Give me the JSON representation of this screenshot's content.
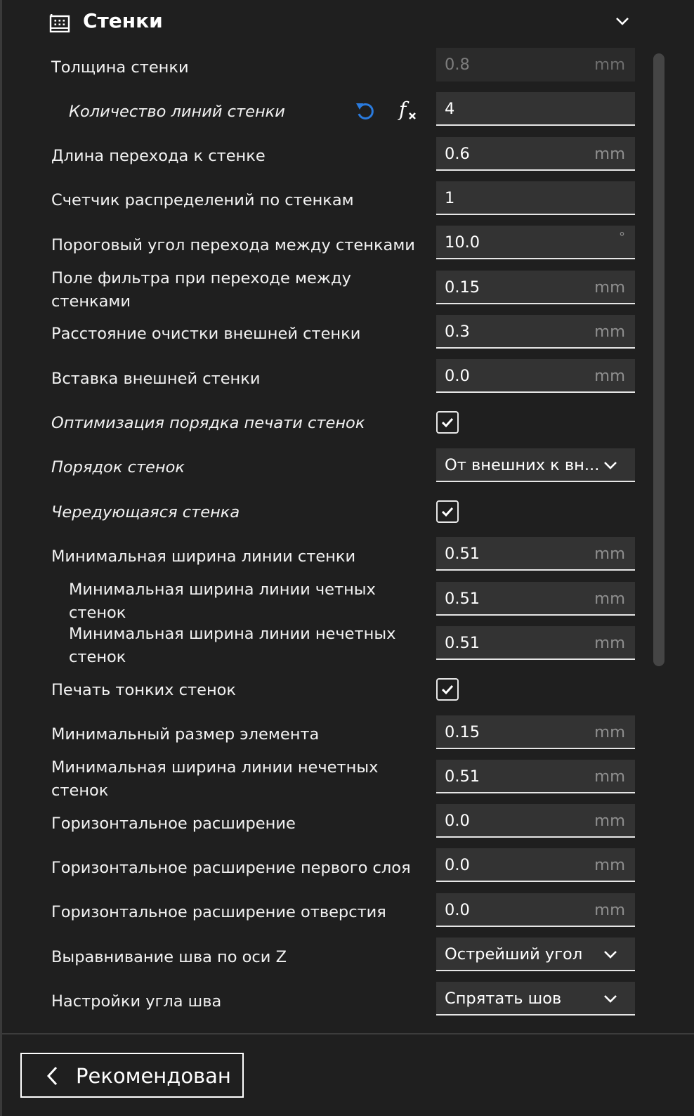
{
  "section": {
    "title": "Стенки",
    "icon": "wall-grid-icon",
    "collapse_icon": "chevron-down-icon"
  },
  "settings": [
    {
      "label": "Толщина стенки",
      "type": "number",
      "value": "0.8",
      "unit": "mm",
      "disabled": true
    },
    {
      "label": "Количество линий стенки",
      "type": "number",
      "value": "4",
      "unit": "",
      "indent": true,
      "italic": true,
      "reset_icon": "reset-icon",
      "function_icon": "fx-icon"
    },
    {
      "label": "Длина перехода к стенке",
      "type": "number",
      "value": "0.6",
      "unit": "mm"
    },
    {
      "label": "Счетчик распределений по стенкам",
      "type": "number",
      "value": "1",
      "unit": ""
    },
    {
      "label": "Пороговый угол перехода между стенками",
      "type": "number",
      "value": "10.0",
      "unit": "°"
    },
    {
      "label": "Поле фильтра при переходе между стенками",
      "type": "number",
      "value": "0.15",
      "unit": "mm"
    },
    {
      "label": "Расстояние очистки внешней стенки",
      "type": "number",
      "value": "0.3",
      "unit": "mm"
    },
    {
      "label": "Вставка внешней стенки",
      "type": "number",
      "value": "0.0",
      "unit": "mm"
    },
    {
      "label": "Оптимизация порядка печати стенок",
      "type": "checkbox",
      "checked": true,
      "italic": true
    },
    {
      "label": "Порядок стенок",
      "type": "select",
      "value": "От внешних к вн...",
      "italic": true
    },
    {
      "label": "Чередующаяся стенка",
      "type": "checkbox",
      "checked": true,
      "italic": true
    },
    {
      "label": "Минимальная ширина линии стенки",
      "type": "number",
      "value": "0.51",
      "unit": "mm"
    },
    {
      "label": "Минимальная ширина линии четных стенок",
      "type": "number",
      "value": "0.51",
      "unit": "mm",
      "indent": true
    },
    {
      "label": "Минимальная ширина линии нечетных стенок",
      "type": "number",
      "value": "0.51",
      "unit": "mm",
      "indent": true
    },
    {
      "label": "Печать тонких стенок",
      "type": "checkbox",
      "checked": true
    },
    {
      "label": "Минимальный размер элемента",
      "type": "number",
      "value": "0.15",
      "unit": "mm"
    },
    {
      "label": "Минимальная ширина линии нечетных стенок",
      "type": "number",
      "value": "0.51",
      "unit": "mm"
    },
    {
      "label": "Горизонтальное расширение",
      "type": "number",
      "value": "0.0",
      "unit": "mm"
    },
    {
      "label": "Горизонтальное расширение первого слоя",
      "type": "number",
      "value": "0.0",
      "unit": "mm"
    },
    {
      "label": "Горизонтальное расширение отверстия",
      "type": "number",
      "value": "0.0",
      "unit": "mm"
    },
    {
      "label": "Выравнивание шва по оси Z",
      "type": "select",
      "value": "Острейший угол"
    },
    {
      "label": "Настройки угла шва",
      "type": "select",
      "value": "Спрятать шов"
    }
  ],
  "footer": {
    "back_label": "Рекомендован",
    "back_icon": "chevron-left-icon"
  },
  "colors": {
    "background": "#1f1f1f",
    "field": "#333333",
    "accent": "#2a7bde"
  }
}
